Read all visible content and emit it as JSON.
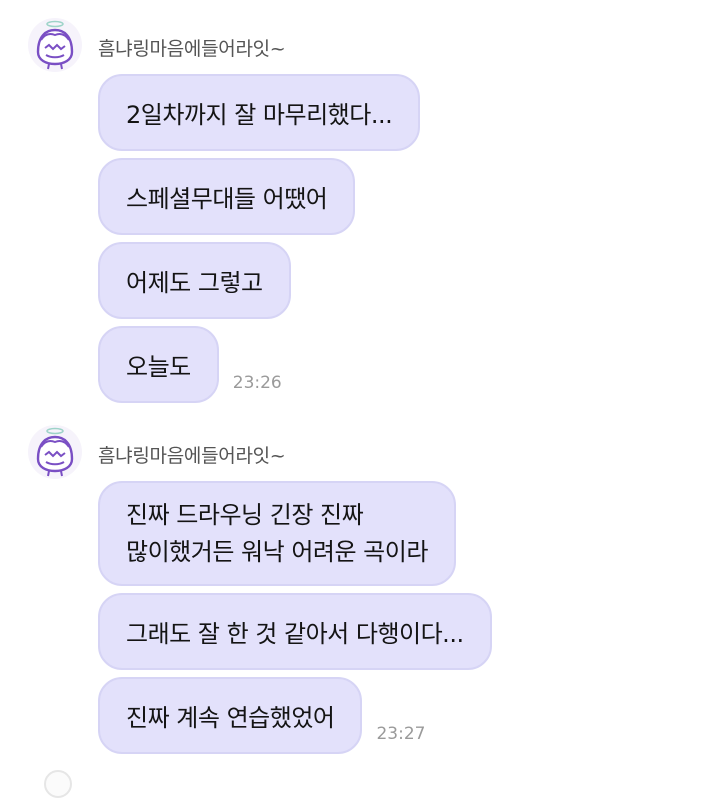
{
  "groups": [
    {
      "sender": "흠냐링마음에들어라잇~",
      "messages": [
        {
          "lines": [
            "2일차까지 잘 마무리했다..."
          ]
        },
        {
          "lines": [
            "스페셜무대들 어땠어"
          ]
        },
        {
          "lines": [
            "어제도 그렇고"
          ]
        },
        {
          "lines": [
            "오늘도"
          ],
          "time": "23:26"
        }
      ]
    },
    {
      "sender": "흠냐링마음에들어라잇~",
      "messages": [
        {
          "lines": [
            "진짜 드라우닝 긴장 진짜",
            "많이했거든 워낙 어려운 곡이라"
          ]
        },
        {
          "lines": [
            "그래도 잘 한 것 같아서 다행이다..."
          ]
        },
        {
          "lines": [
            "진짜 계속 연습했었어"
          ],
          "time": "23:27"
        }
      ]
    }
  ],
  "colors": {
    "bubble": "#e3e1fb",
    "bubble_border": "#d6d4f5",
    "avatar_accent": "#7a4fc4"
  },
  "icons": {
    "avatar": "cartoon-character-avatar-icon"
  }
}
